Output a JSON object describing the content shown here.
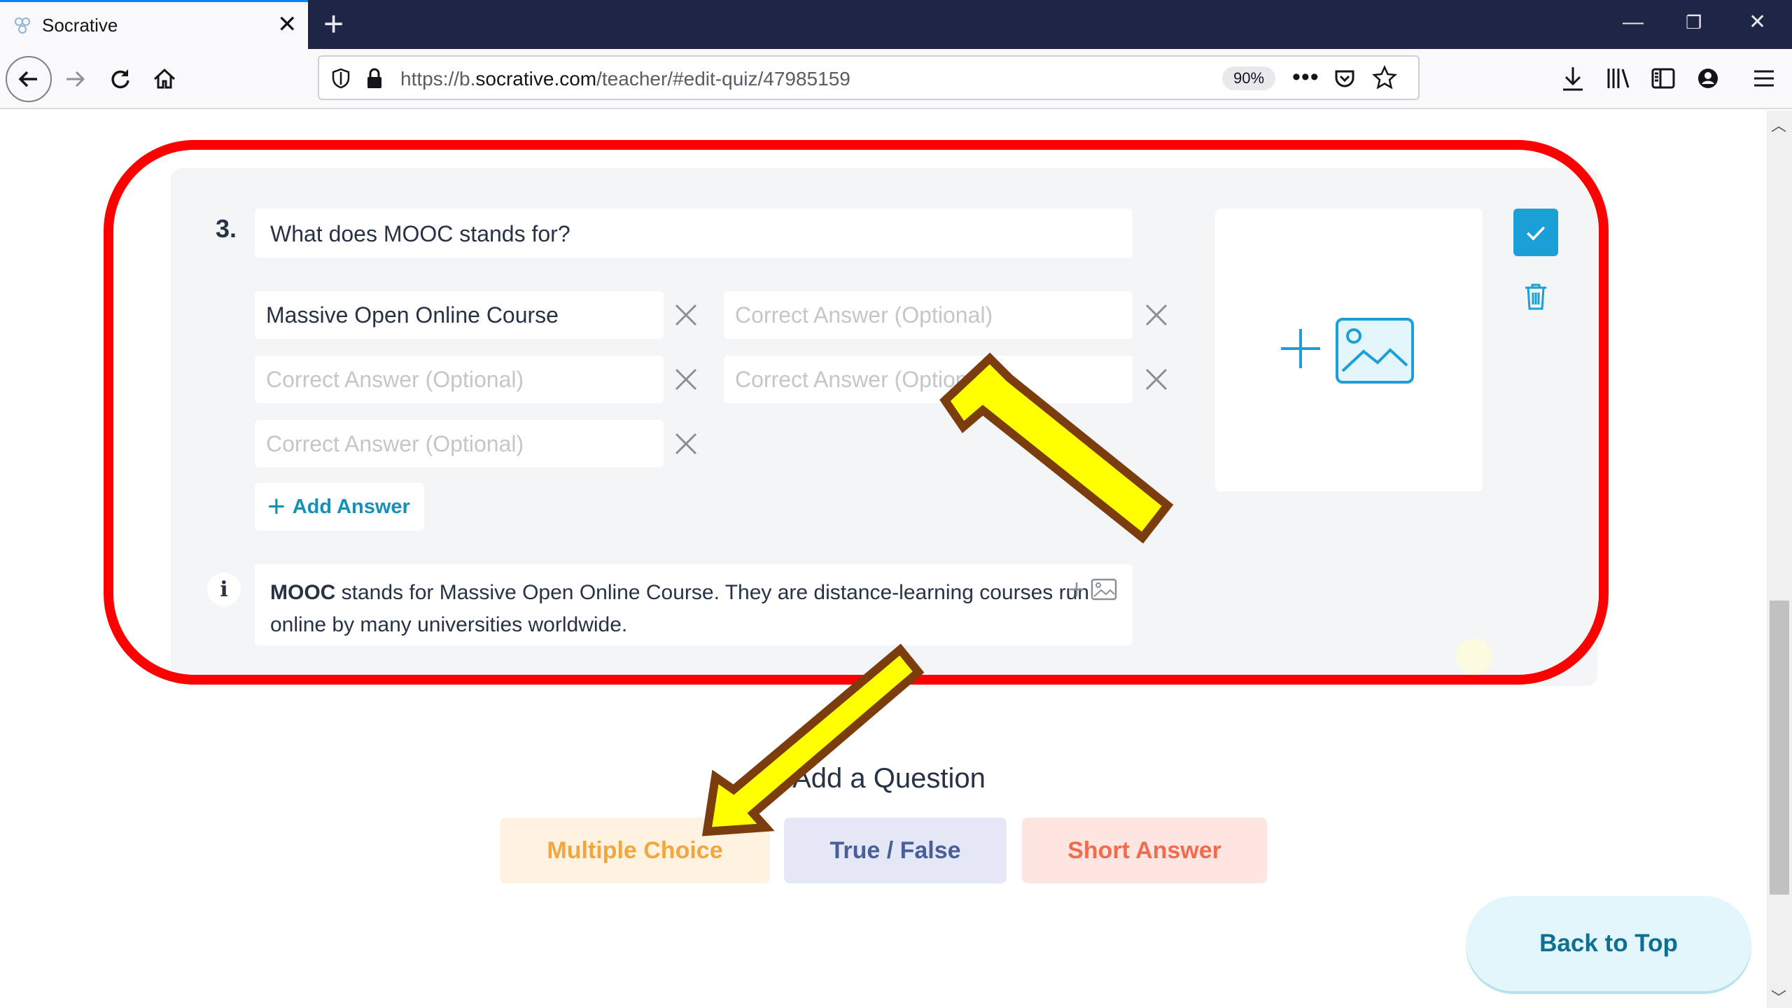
{
  "browser": {
    "tab_title": "Socrative",
    "url_prefix": "https://b.",
    "url_domain": "socrative.com",
    "url_path": "/teacher/#edit-quiz/47985159",
    "zoom": "90%"
  },
  "question": {
    "number": "3.",
    "text": "What does MOOC stands for?",
    "answers": [
      {
        "value": "Massive Open Online Course",
        "placeholder": "Correct Answer (Optional)"
      },
      {
        "value": "",
        "placeholder": "Correct Answer (Optional)"
      },
      {
        "value": "",
        "placeholder": "Correct Answer (Optional)"
      },
      {
        "value": "",
        "placeholder": "Correct Answer (Optional)"
      },
      {
        "value": "",
        "placeholder": "Correct Answer (Optional)"
      }
    ],
    "add_answer_label": "Add Answer",
    "explanation_bold": "MOOC",
    "explanation_rest": " stands for Massive Open Online Course. They are distance-learning courses run online by many universities worldwide."
  },
  "add_question": {
    "title": "Add a Question",
    "multiple_choice": "Multiple Choice",
    "true_false": "True / False",
    "short_answer": "Short Answer"
  },
  "back_to_top": "Back to Top",
  "colors": {
    "accent": "#1a9fd6",
    "annotation_frame": "#ff0000",
    "annotation_arrow": "#ffff00",
    "annotation_arrow_outline": "#7b3c0e"
  }
}
